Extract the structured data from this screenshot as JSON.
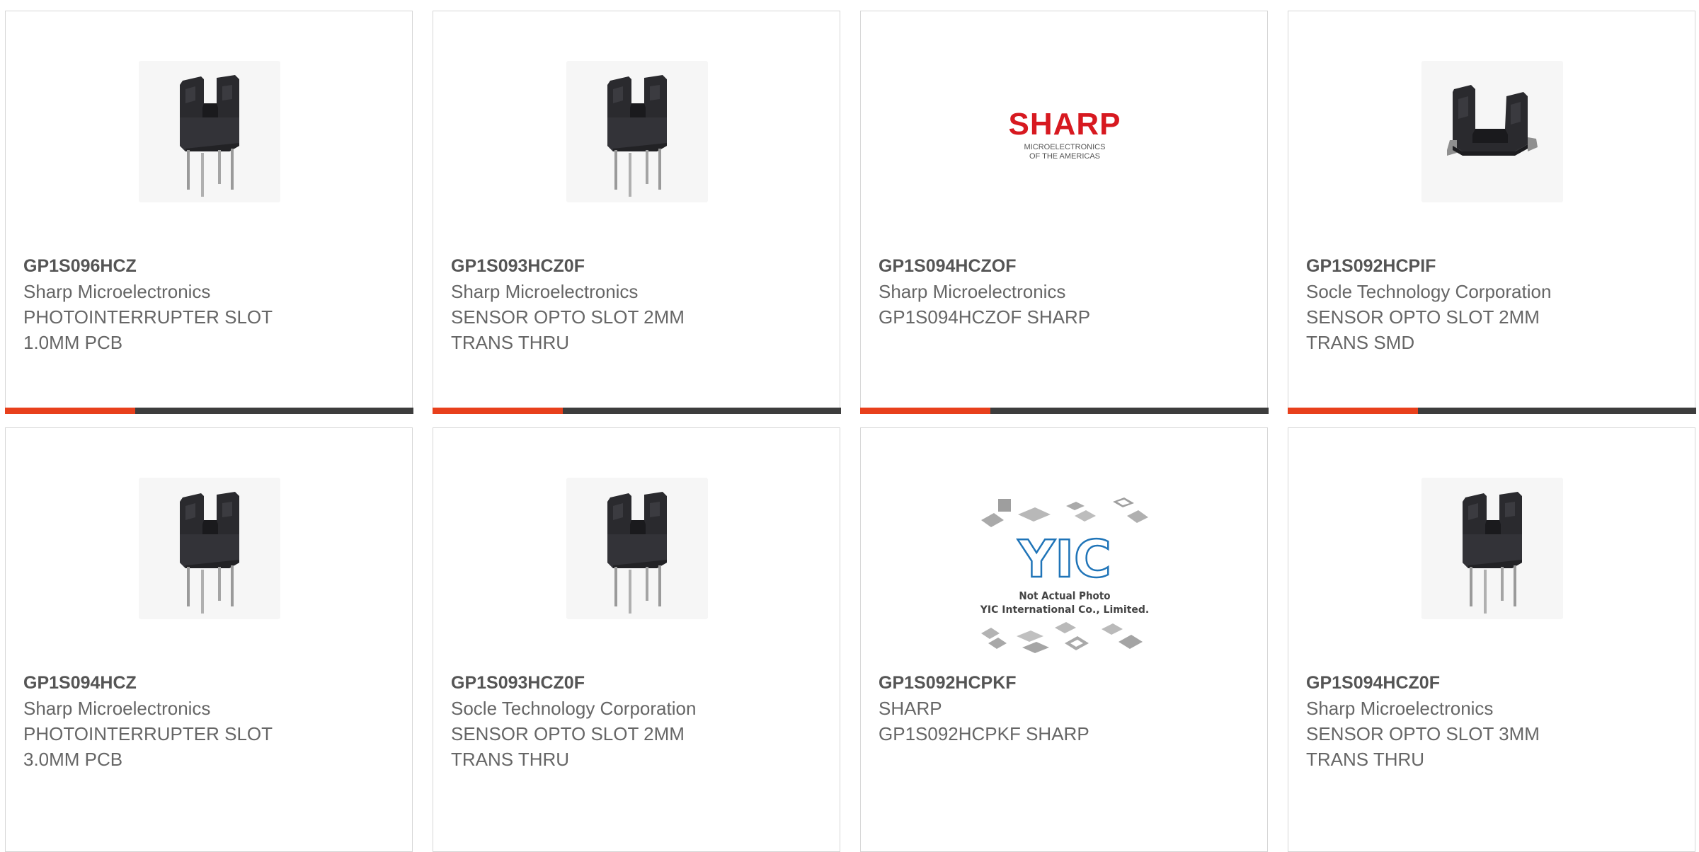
{
  "colors": {
    "accent": "#e8401c",
    "bar_dark": "#3d3d3d",
    "border": "#d6d6d6",
    "sharp_red": "#d71920",
    "yic_blue": "#1f74b8"
  },
  "products": [
    {
      "part": "GP1S096HCZ",
      "manufacturer": "Sharp Microelectronics",
      "desc1": "PHOTOINTERRUPTER SLOT",
      "desc2": "1.0MM PCB",
      "image": "photointerrupter-image"
    },
    {
      "part": "GP1S093HCZ0F",
      "manufacturer": "Sharp Microelectronics",
      "desc1": "SENSOR OPTO SLOT 2MM",
      "desc2": "TRANS THRU",
      "image": "photointerrupter-image"
    },
    {
      "part": "GP1S094HCZOF",
      "manufacturer": "Sharp Microelectronics",
      "desc1": "GP1S094HCZOF SHARP",
      "desc2": "",
      "image": "sharp-logo",
      "logo": {
        "brand": "SHARP",
        "tagline1": "MICROELECTRONICS",
        "tagline2": "OF THE AMERICAS"
      }
    },
    {
      "part": "GP1S092HCPIF",
      "manufacturer": "Socle Technology Corporation",
      "desc1": "SENSOR OPTO SLOT 2MM",
      "desc2": "TRANS SMD",
      "image": "smd-photointerrupter-image"
    },
    {
      "part": "GP1S094HCZ",
      "manufacturer": "Sharp Microelectronics",
      "desc1": "PHOTOINTERRUPTER SLOT",
      "desc2": "3.0MM PCB",
      "image": "photointerrupter-image"
    },
    {
      "part": "GP1S093HCZ0F",
      "manufacturer": "Socle Technology Corporation",
      "desc1": "SENSOR OPTO SLOT 2MM",
      "desc2": "TRANS THRU",
      "image": "photointerrupter-image"
    },
    {
      "part": "GP1S092HCPKF",
      "manufacturer": "SHARP",
      "desc1": "GP1S092HCPKF SHARP",
      "desc2": "",
      "image": "yic-placeholder",
      "placeholder": {
        "brand": "YIC",
        "note1": "Not Actual Photo",
        "note2": "YIC International Co., Limited."
      }
    },
    {
      "part": "GP1S094HCZ0F",
      "manufacturer": "Sharp Microelectronics",
      "desc1": "SENSOR OPTO SLOT 3MM",
      "desc2": "TRANS THRU",
      "image": "photointerrupter-image"
    }
  ]
}
